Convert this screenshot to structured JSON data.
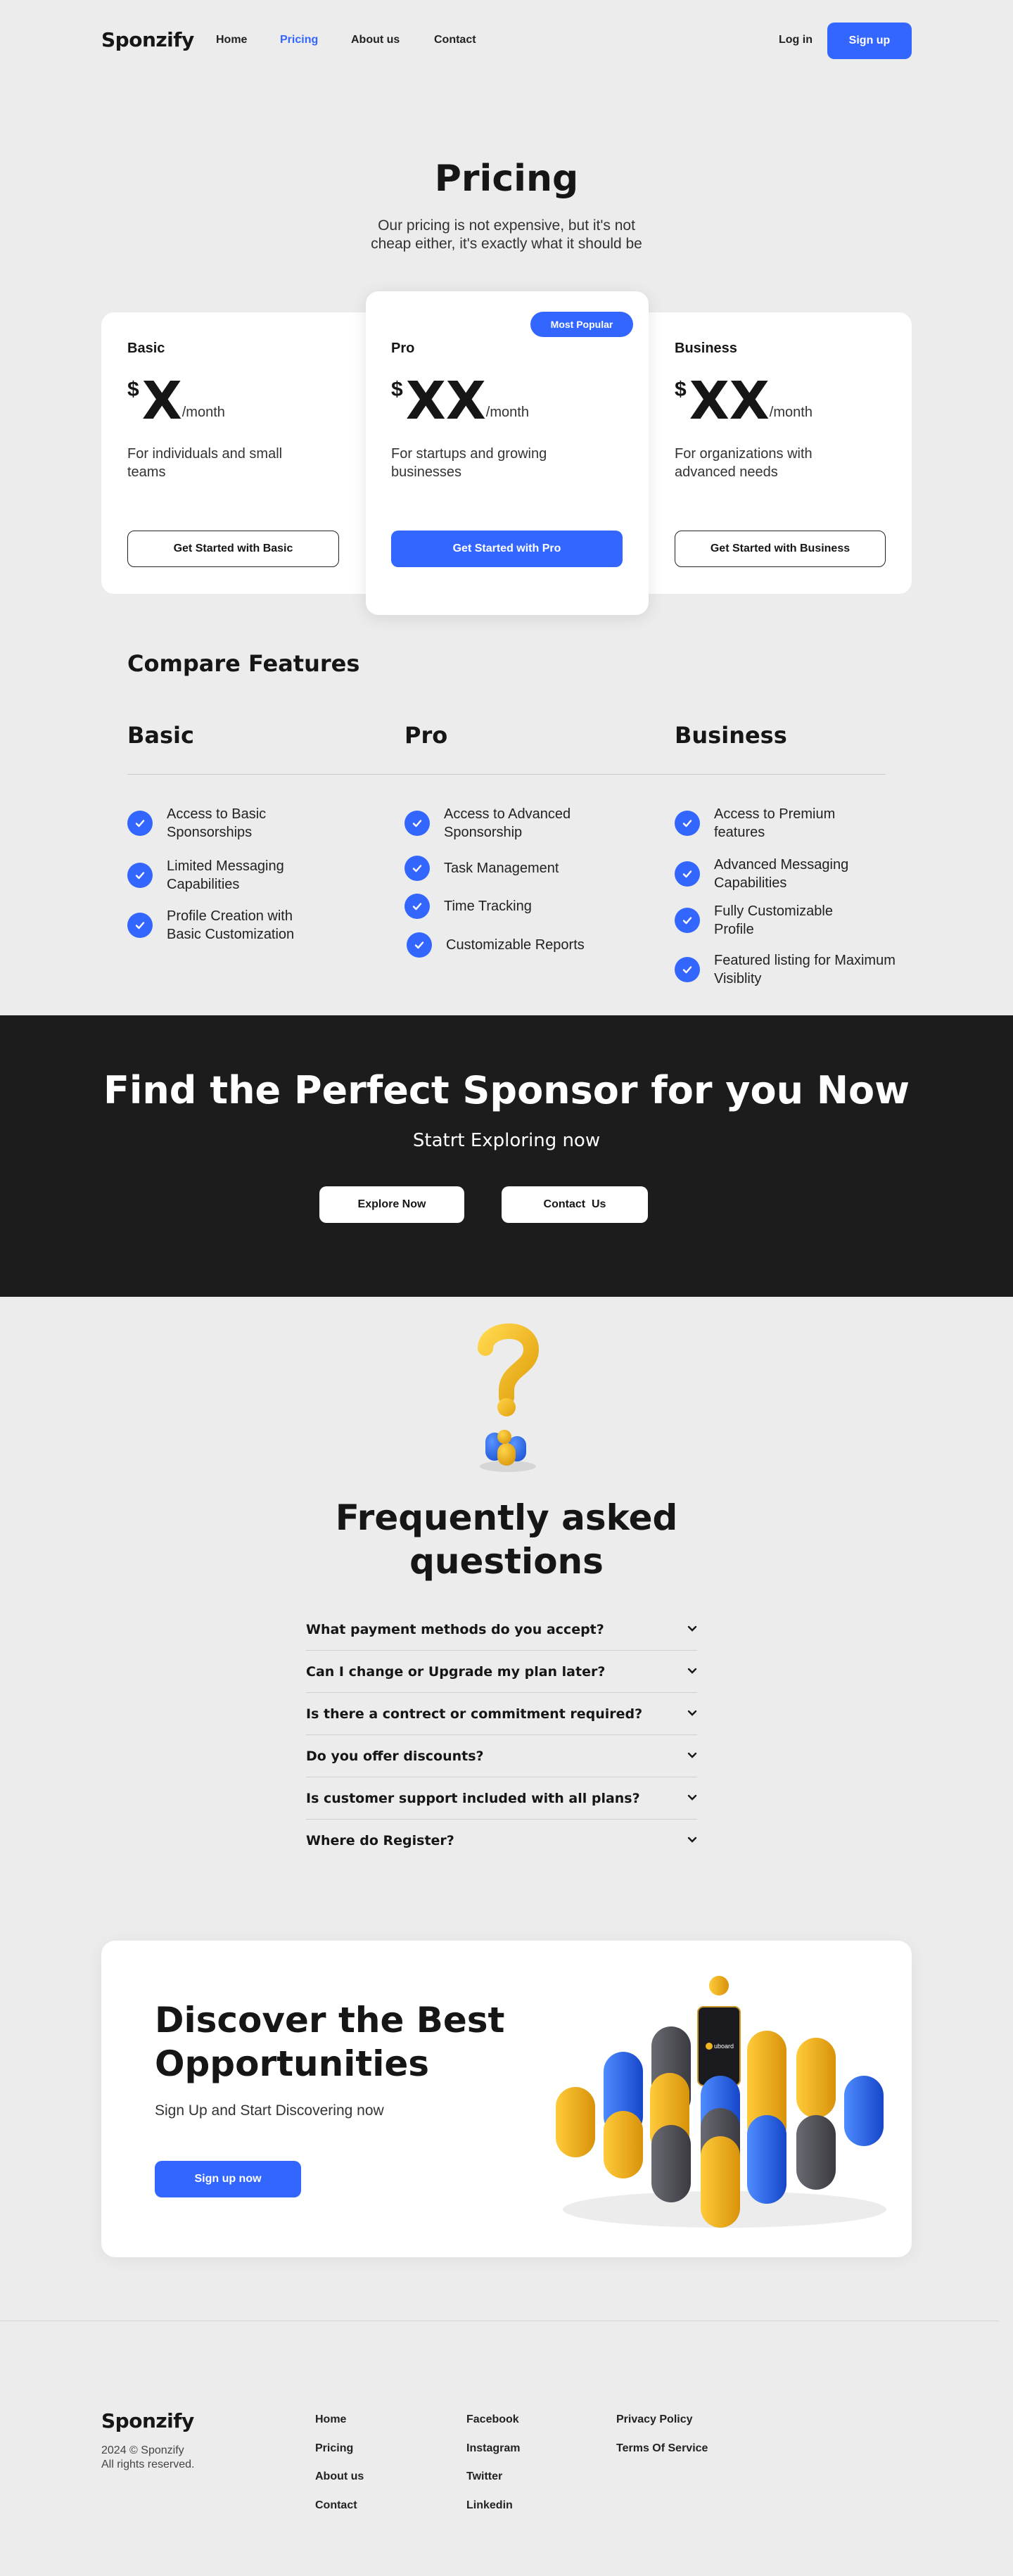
{
  "nav": {
    "logo": "Sponzify",
    "links": [
      "Home",
      "Pricing",
      "About us",
      "Contact"
    ],
    "active": "Pricing",
    "login": "Log in",
    "signup": "Sign up"
  },
  "pricing": {
    "title": "Pricing",
    "subtitle_line1": "Our pricing is not expensive, but it's not",
    "subtitle_line2": "cheap either, it's exactly what it should be",
    "plans": [
      {
        "name": "Basic",
        "currency": "$",
        "amount": "X",
        "period": "/month",
        "desc_line1": "For individuals and small",
        "desc_line2": "teams",
        "cta": "Get Started with Basic"
      },
      {
        "name": "Pro",
        "currency": "$",
        "amount": "XX",
        "period": "/month",
        "desc_line1": "For startups and growing",
        "desc_line2": "businesses",
        "cta": "Get Started with Pro",
        "badge": "Most Popular"
      },
      {
        "name": "Business",
        "currency": "$",
        "amount": "XX",
        "period": "/month",
        "desc_line1": "For organizations with",
        "desc_line2": "advanced needs",
        "cta": "Get Started with Business"
      }
    ]
  },
  "compare": {
    "title": "Compare Features",
    "columns": [
      {
        "title": "Basic",
        "features": [
          [
            "Access to Basic",
            "Sponsorships"
          ],
          [
            "Limited Messaging",
            "Capabilities"
          ],
          [
            "Profile Creation with",
            "Basic Customization"
          ]
        ]
      },
      {
        "title": "Pro",
        "features": [
          [
            "Access to Advanced",
            "Sponsorship"
          ],
          [
            "Task Management",
            ""
          ],
          [
            "Time Tracking",
            ""
          ],
          [
            "Customizable Reports",
            ""
          ]
        ]
      },
      {
        "title": "Business",
        "features": [
          [
            "Access to Premium",
            "features"
          ],
          [
            "Advanced Messaging",
            "Capabilities"
          ],
          [
            "Fully Customizable",
            "Profile"
          ],
          [
            "Featured listing for Maximum",
            "Visiblity"
          ]
        ]
      }
    ]
  },
  "cta": {
    "title": "Find the Perfect Sponsor for you Now",
    "subtitle": "Statrt Exploring now",
    "explore": "Explore Now",
    "contact": "Contact  Us"
  },
  "faq": {
    "title_line1": "Frequently asked",
    "title_line2": "questions",
    "items": [
      "What payment methods do you accept?",
      "Can I change or Upgrade my plan later?",
      "Is there a contrect or commitment required?",
      "Do you offer discounts?",
      "Is customer support included with all plans?",
      "Where do Register?"
    ]
  },
  "discover": {
    "title_line1": "Discover the Best",
    "title_line2": "Opportunities",
    "subtitle": "Sign Up and Start Discovering now",
    "cta": "Sign up now",
    "phone_label": "uboard"
  },
  "footer": {
    "logo": "Sponzify",
    "copy_line1": "2024 © Sponzify",
    "copy_line2": "All rights reserved.",
    "col1": [
      "Home",
      "Pricing",
      "About us",
      "Contact"
    ],
    "col2": [
      "Facebook",
      "Instagram",
      "Twitter",
      "Linkedin"
    ],
    "col3": [
      "Privacy Policy",
      "Terms Of Service"
    ]
  },
  "colors": {
    "accent": "#3366ff",
    "dark": "#1c1c1c",
    "background": "#ececec",
    "yellow": "#f0b41e"
  }
}
